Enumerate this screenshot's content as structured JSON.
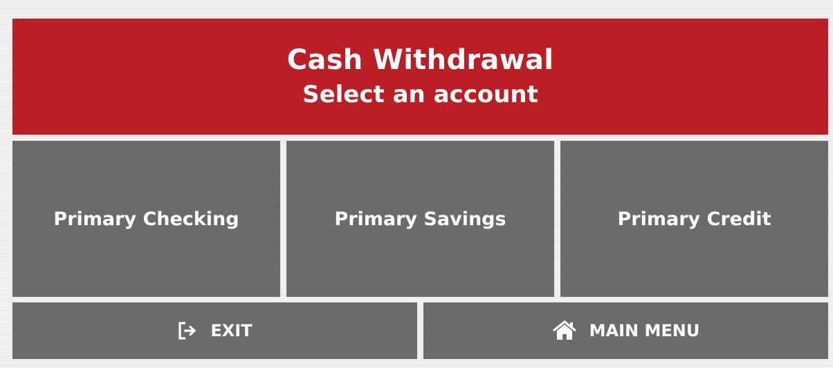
{
  "header": {
    "title": "Cash Withdrawal",
    "subtitle": "Select an account"
  },
  "accounts": [
    {
      "label": "Primary Checking"
    },
    {
      "label": "Primary Savings"
    },
    {
      "label": "Primary Credit"
    }
  ],
  "nav": {
    "exit_label": "EXIT",
    "exit_icon": "sign-out-icon",
    "main_menu_label": "MAIN MENU",
    "main_menu_icon": "home-icon"
  },
  "colors": {
    "header_bg": "#b91f25",
    "tile_bg": "#6b6b6e",
    "text": "#ffffff",
    "page_bg": "#eeeeee"
  }
}
